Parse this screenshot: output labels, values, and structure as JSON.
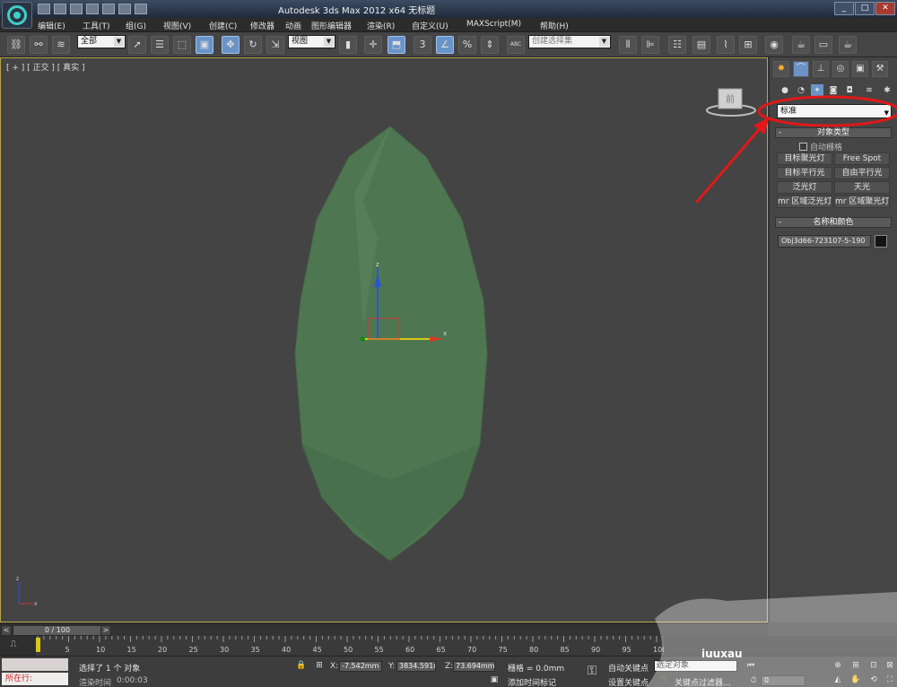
{
  "window": {
    "title": "Autodesk 3ds Max  2012 x64     无标题",
    "minimize_glyph": "_",
    "maximize_glyph": "□",
    "close_glyph": "✕"
  },
  "menu": [
    "编辑(E)",
    "工具(T)",
    "组(G)",
    "视图(V)",
    "创建(C)",
    "修改器",
    "动画",
    "图形编辑器",
    "渲染(R)",
    "自定义(U)",
    "MAXScript(M)",
    "帮助(H)"
  ],
  "toolbar": {
    "selection_filter": "全部",
    "reference_coord": "视图",
    "snap_label": "3",
    "percent_label": "%",
    "named_selection_placeholder": "创建选择集",
    "abc_label": "ABC"
  },
  "viewport": {
    "label": "[ + ] [ 正交 ] [ 真实 ]",
    "viewcube_label": "前",
    "gizmo_axis": {
      "x": "x",
      "z": "z"
    },
    "object_color": "#4f7a52"
  },
  "command_panel": {
    "category": "标准",
    "object_type_title": "对象类型",
    "autogrid_label": "自动栅格",
    "buttons": [
      "目标聚光灯",
      "Free Spot",
      "目标平行光",
      "自由平行光",
      "泛光灯",
      "天光",
      "mr 区域泛光灯",
      "mr 区域聚光灯"
    ],
    "name_color_title": "名称和颜色",
    "object_name": "Obj3d66-723107-5-190",
    "object_color": "#141414",
    "rollout_sign": "-"
  },
  "timeline": {
    "frame_display": "0 / 100",
    "prev_arrow": "<",
    "next_arrow": ">",
    "ticks": [
      "0",
      "5",
      "10",
      "15",
      "20",
      "25",
      "30",
      "35",
      "40",
      "45",
      "50",
      "55",
      "60",
      "65",
      "70",
      "75",
      "80",
      "85",
      "90",
      "95",
      "100"
    ]
  },
  "status": {
    "maxscript_line": "所在行:",
    "selection_text": "选择了 1 个 对象",
    "render_time_label": "渲染时间",
    "render_time_value": "0:00:03",
    "x_label": "X:",
    "x_value": "-7.542mm",
    "y_label": "Y:",
    "y_value": "3834.591m",
    "z_label": "Z:",
    "z_value": "73.694mm",
    "grid_text": "栅格 = 0.0mm",
    "add_time_tag": "添加时间标记",
    "auto_key": "自动关键点",
    "set_key": "设置关键点",
    "key_mode": "选定对象",
    "key_filters": "关键点过滤器...",
    "frame_value": "0"
  },
  "watermark": "iuuxau"
}
